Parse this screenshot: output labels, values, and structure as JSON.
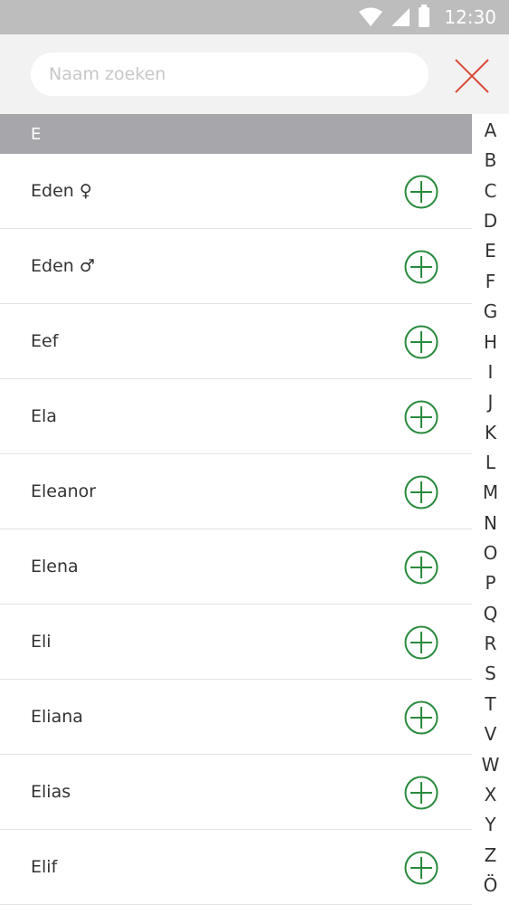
{
  "status_bar": {
    "time": "12:30",
    "icons": [
      "wifi-icon",
      "signal-icon",
      "battery-icon"
    ]
  },
  "search": {
    "placeholder": "Naam zoeken",
    "value": ""
  },
  "close": {
    "icon": "close-icon",
    "color": "#d94a38"
  },
  "section": {
    "letter": "E"
  },
  "names": [
    {
      "label": "Eden ♀"
    },
    {
      "label": "Eden ♂"
    },
    {
      "label": "Eef"
    },
    {
      "label": "Ela"
    },
    {
      "label": "Eleanor"
    },
    {
      "label": "Elena"
    },
    {
      "label": "Eli"
    },
    {
      "label": "Eliana"
    },
    {
      "label": "Elias"
    },
    {
      "label": "Elif"
    }
  ],
  "add_icon": {
    "icon": "plus-circle-icon",
    "color": "#2a8a3e"
  },
  "index_letters": [
    "A",
    "B",
    "C",
    "D",
    "E",
    "F",
    "G",
    "H",
    "I",
    "J",
    "K",
    "L",
    "M",
    "N",
    "O",
    "P",
    "Q",
    "R",
    "S",
    "T",
    "V",
    "W",
    "X",
    "Y",
    "Z",
    "Ö"
  ]
}
